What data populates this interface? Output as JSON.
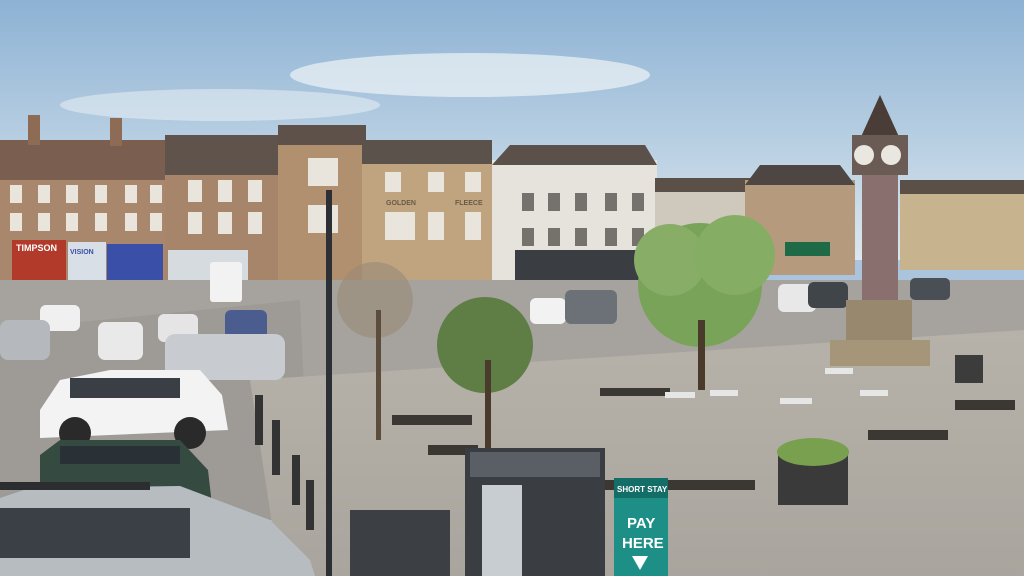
{
  "scene": {
    "description_free": true
  },
  "signs": {
    "shop_timpson": "TIMPSON",
    "shop_vision": "VISION",
    "building_golden": "GOLDEN",
    "building_fleece": "FLEECE",
    "parking_top": "SHORT STAY",
    "parking_main": "PAY",
    "parking_main2": "HERE"
  },
  "colors": {
    "sky_top": "#8fb4d6",
    "sky_bottom": "#d9e6ee",
    "brick": "#a7856a",
    "roof": "#5c4f47",
    "paving": "#b9b5ad",
    "road": "#9c9a96",
    "tree": "#6f9b4e",
    "parking_sign": "#1b8e86"
  }
}
